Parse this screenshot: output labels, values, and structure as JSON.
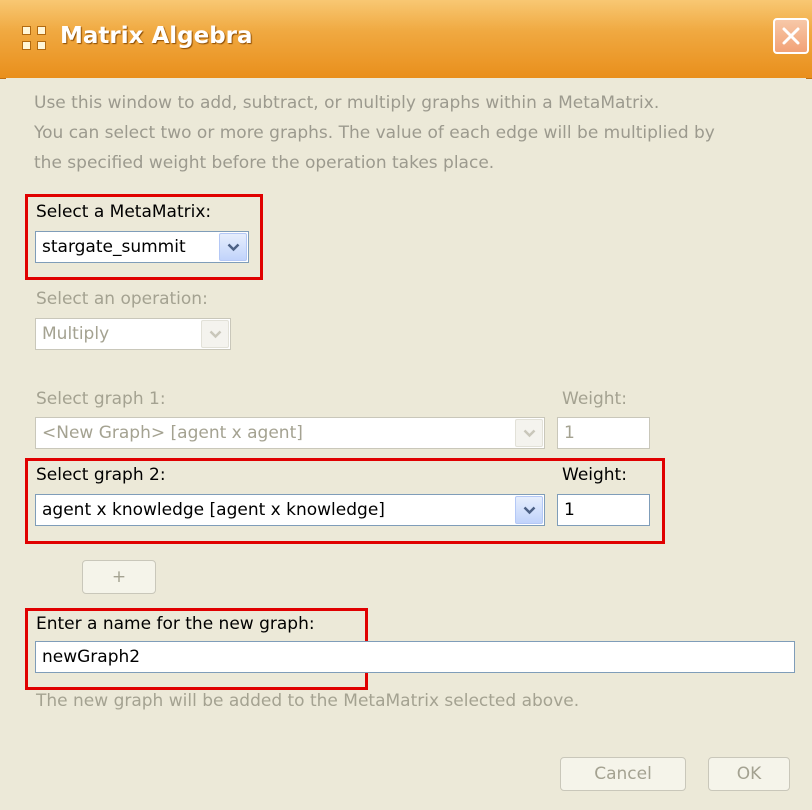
{
  "window": {
    "title": "Matrix Algebra"
  },
  "description": [
    "Use this window to add, subtract, or multiply graphs within a MetaMatrix.",
    "You can select two or more graphs. The value of each edge will be multiplied by",
    "the specified weight before the operation takes place."
  ],
  "metamatrix": {
    "label": "Select a MetaMatrix:",
    "value": "stargate_summit"
  },
  "operation": {
    "label": "Select an operation:",
    "value": "Multiply"
  },
  "graph1": {
    "label": "Select graph 1:",
    "value": "<New Graph> [agent x agent]",
    "weight_label": "Weight:",
    "weight_value": "1"
  },
  "graph2": {
    "label": "Select graph 2:",
    "value": "agent x knowledge [agent x knowledge]",
    "weight_label": "Weight:",
    "weight_value": "1"
  },
  "add_graph_button": "+",
  "new_graph": {
    "label": "Enter a name for the new graph:",
    "value": "newGraph2",
    "hint": "The new graph will be added to the MetaMatrix selected above."
  },
  "buttons": {
    "cancel": "Cancel",
    "ok": "OK"
  },
  "colors": {
    "highlight": "#e00000",
    "titlebar": "#f0a941",
    "dialog_bg": "#ece9d8"
  }
}
